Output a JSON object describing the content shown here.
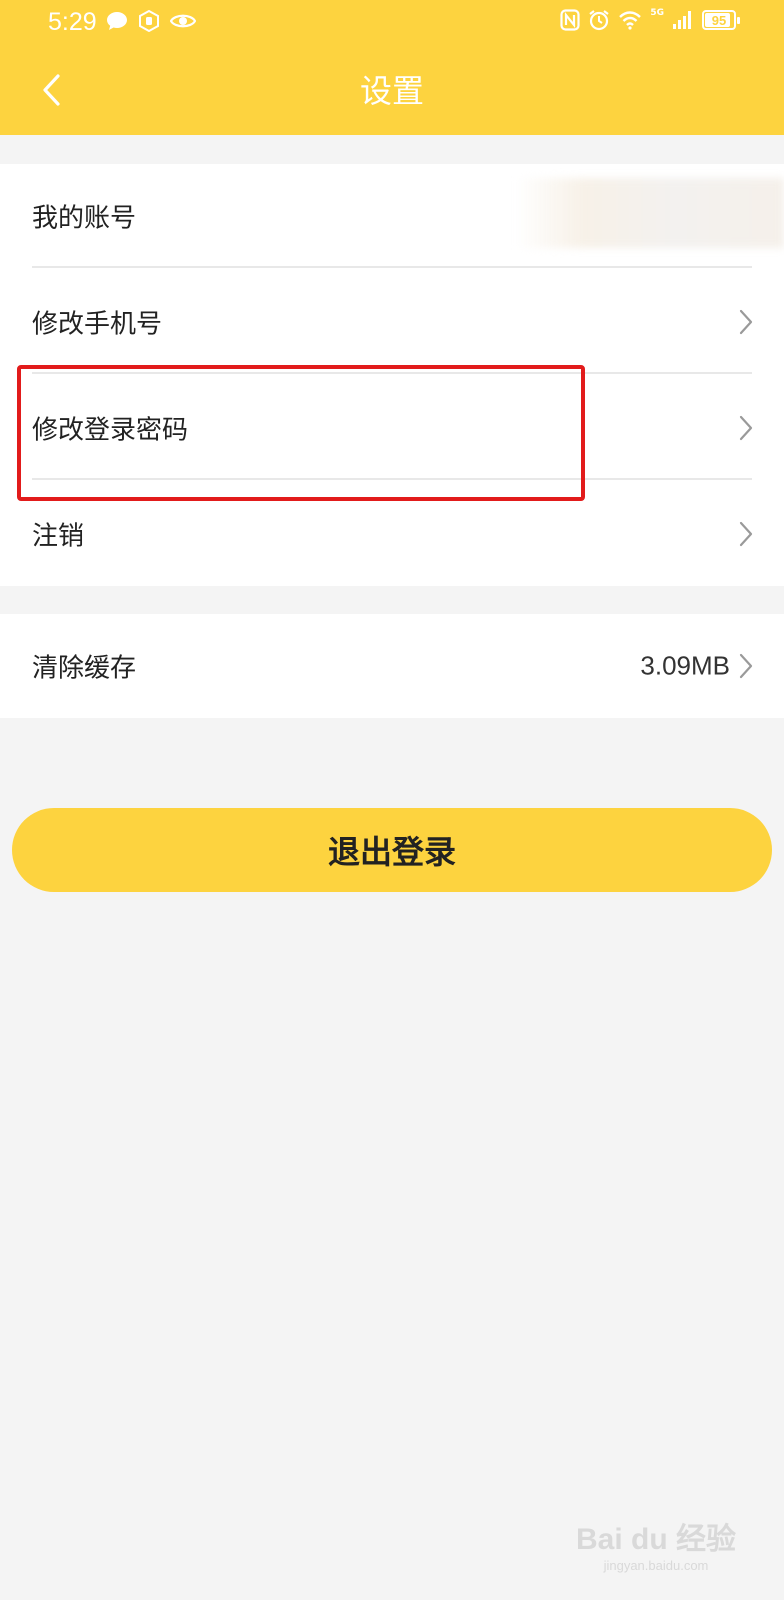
{
  "status_bar": {
    "time": "5:29",
    "battery": "95",
    "network": "5G",
    "left_icons": [
      "message-bubble-icon",
      "hand-app-icon",
      "eye-icon"
    ],
    "right_icons": [
      "nfc-icon",
      "alarm-icon",
      "wifi-icon",
      "signal-icon"
    ]
  },
  "header": {
    "title": "设置",
    "back_icon": "chevron-left-icon",
    "background": "#fdd33f"
  },
  "settings": {
    "account": {
      "label": "我的账号"
    },
    "items": [
      {
        "label": "修改手机号",
        "icon": "chevron-right-icon"
      },
      {
        "label": "修改登录密码",
        "icon": "chevron-right-icon"
      },
      {
        "label": "注销",
        "icon": "chevron-right-icon"
      }
    ],
    "cache": {
      "label": "清除缓存",
      "value": "3.09MB",
      "icon": "chevron-right-icon"
    }
  },
  "logout": {
    "label": "退出登录"
  },
  "highlight_color": "#e21b1b",
  "watermark": {
    "text": "Bai du 经验",
    "url": "jingyan.baidu.com"
  }
}
